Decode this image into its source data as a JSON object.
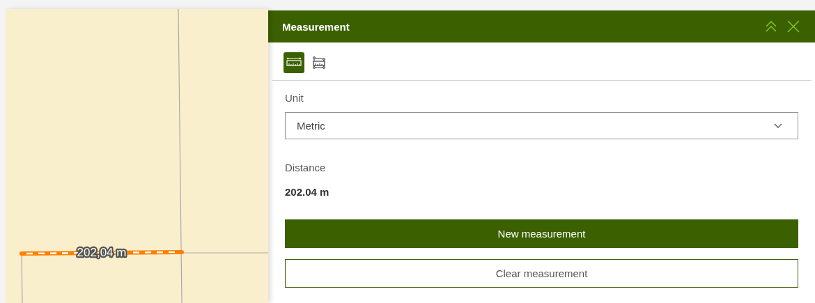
{
  "map": {
    "measurement_label": "202,04 m"
  },
  "panel": {
    "title": "Measurement",
    "header_buttons": [
      {
        "kind": "collapse"
      },
      {
        "kind": "close"
      }
    ],
    "tools": [
      {
        "kind": "distance",
        "selected": true
      },
      {
        "kind": "area",
        "selected": false
      }
    ],
    "unit": {
      "label": "Unit",
      "value": "Metric"
    },
    "result": {
      "label": "Distance",
      "value": "202.04 m"
    },
    "buttons": [
      {
        "label": "New measurement",
        "kind": "primary"
      },
      {
        "label": "Clear measurement",
        "kind": "secondary"
      }
    ]
  }
}
